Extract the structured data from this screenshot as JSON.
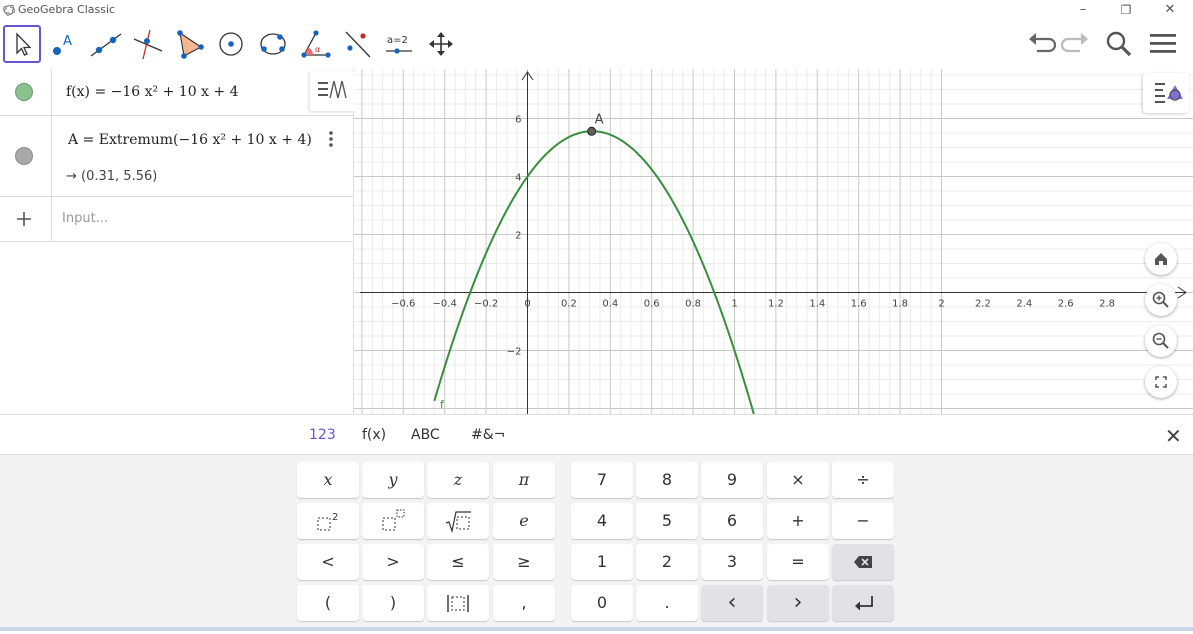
{
  "window": {
    "title": "GeoGebra Classic",
    "controls": [
      "–",
      "❐",
      "✕"
    ]
  },
  "toolbar": {
    "tools": [
      {
        "name": "move-tool-icon",
        "selected": true
      },
      {
        "name": "point-tool-icon",
        "label": "A"
      },
      {
        "name": "line-tool-icon"
      },
      {
        "name": "perpendicular-line-tool-icon"
      },
      {
        "name": "polygon-tool-icon"
      },
      {
        "name": "circle-center-point-tool-icon"
      },
      {
        "name": "conic-tool-icon"
      },
      {
        "name": "angle-tool-icon"
      },
      {
        "name": "reflect-tool-icon"
      },
      {
        "name": "slider-tool-icon",
        "label": "a=2"
      },
      {
        "name": "move-graphics-view-tool-icon"
      }
    ],
    "right": [
      "undo-icon",
      "redo-icon",
      "search-icon",
      "menu-icon"
    ]
  },
  "algebra": {
    "rows": [
      {
        "expr_lhs": "f(x)",
        "expr_rhs": "−16 x² + 10 x + 4",
        "marble_color": "#8bc28f",
        "visible": true
      },
      {
        "expr_lhs": "A",
        "expr_rhs": "Extremum(−16 x² + 10 x + 4)",
        "output": "→ (0.31, 5.56)",
        "marble_color": "#a9a9a9",
        "visible": true
      }
    ],
    "input_placeholder": "Input..."
  },
  "graphics": {
    "x_ticks": [
      "−0.6",
      "−0.4",
      "−0.2",
      "0",
      "0.2",
      "0.4",
      "0.6",
      "0.8",
      "1",
      "1.2",
      "1.4",
      "1.6",
      "1.8",
      "2",
      "2.2",
      "2.4",
      "2.6",
      "2.8"
    ],
    "y_ticks": [
      "6",
      "4",
      "2",
      "−2"
    ],
    "point_label": "A",
    "curve_label": "f",
    "curve_color": "#388e3c",
    "point": {
      "x": 0.31,
      "y": 5.56
    }
  },
  "keyboard": {
    "tabs": [
      "123",
      "f(x)",
      "ABC",
      "#&¬"
    ],
    "active_tab": "123",
    "left_keys": [
      [
        "x",
        "y",
        "z",
        "π"
      ],
      [
        "□²",
        "□ⁿ",
        "√□",
        "e"
      ],
      [
        "<",
        ">",
        "≤",
        "≥"
      ],
      [
        "(",
        ")",
        "|□|",
        ","
      ]
    ],
    "right_keys": [
      [
        "7",
        "8",
        "9",
        "×",
        "÷"
      ],
      [
        "4",
        "5",
        "6",
        "+",
        "−"
      ],
      [
        "1",
        "2",
        "3",
        "=",
        "⌫"
      ],
      [
        "0",
        ".",
        "‹",
        "›",
        "↵"
      ]
    ]
  },
  "colors": {
    "accent": "#6557d2",
    "curve": "#388e3c"
  }
}
